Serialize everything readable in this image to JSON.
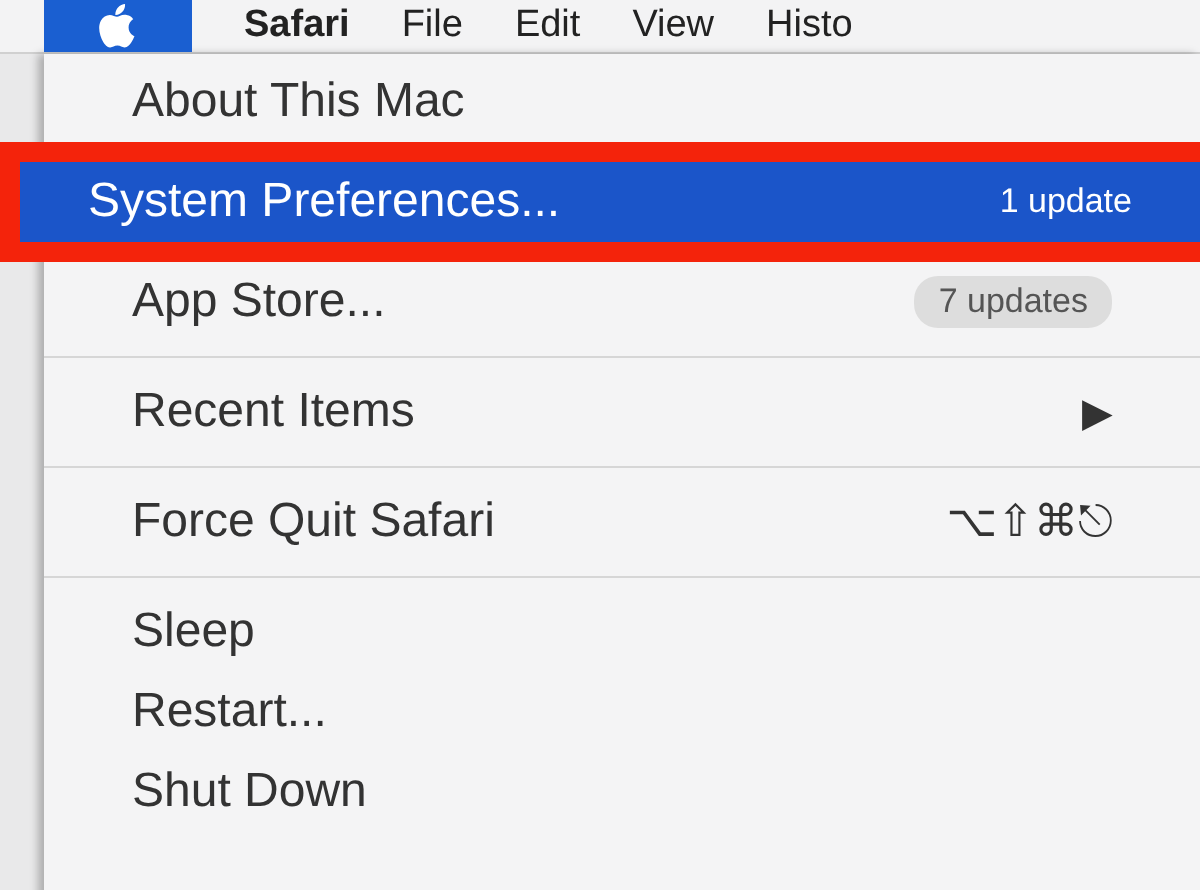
{
  "menu_bar": {
    "apple_selected": true,
    "items": [
      {
        "label": "Safari",
        "bold": true
      },
      {
        "label": "File",
        "bold": false
      },
      {
        "label": "Edit",
        "bold": false
      },
      {
        "label": "View",
        "bold": false
      },
      {
        "label": "Histo",
        "bold": false
      }
    ]
  },
  "menu": [
    {
      "kind": "item",
      "label": "About This Mac",
      "selected": false
    },
    {
      "kind": "item",
      "label": "System Preferences...",
      "selected": true,
      "badge": "1 update",
      "annotated": true
    },
    {
      "kind": "item",
      "label": "App Store...",
      "selected": false,
      "badge": "7 updates"
    },
    {
      "kind": "separator"
    },
    {
      "kind": "item",
      "label": "Recent Items",
      "selected": false,
      "arrow": "▶"
    },
    {
      "kind": "separator"
    },
    {
      "kind": "item",
      "label": "Force Quit Safari",
      "selected": false,
      "shortcut": "⌥⇧⌘⎋"
    },
    {
      "kind": "separator"
    },
    {
      "kind": "item",
      "label": "Sleep",
      "selected": false
    },
    {
      "kind": "item",
      "label": "Restart...",
      "selected": false
    },
    {
      "kind": "item",
      "label": "Shut Down",
      "selected": false
    }
  ]
}
